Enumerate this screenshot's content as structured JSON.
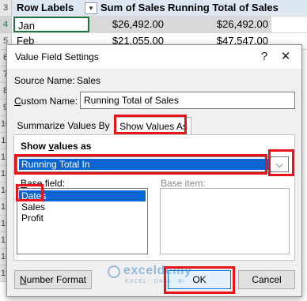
{
  "sheet": {
    "row_numbers": [
      "3",
      "4",
      "5"
    ],
    "headers": {
      "row_labels": "Row Labels",
      "sum_of_sales": "Sum of Sales",
      "running_total": "Running Total of Sales"
    },
    "rows": [
      {
        "label": "Jan",
        "sum": "$26,492.00",
        "running": "$26,492.00"
      },
      {
        "label": "Feb",
        "sum": "$21,055.00",
        "running": "$47,547.00"
      }
    ],
    "side_row_numbers": [
      "6",
      "7",
      "8",
      "9",
      "10",
      "11",
      "12",
      "13",
      "14",
      "15",
      "16",
      "17",
      "18",
      "19"
    ]
  },
  "dialog": {
    "title": "Value Field Settings",
    "help_icon": "question-mark-icon",
    "close_icon": "close-icon",
    "source_name_label": "Source Name:",
    "source_name_value": "Sales",
    "custom_name_label": "Custom Name:",
    "custom_name_value": "Running Total of Sales",
    "tabs": [
      "Summarize Values By",
      "Show Values As"
    ],
    "active_tab": "Show Values As",
    "show_values_as_label": "Show values as",
    "show_values_as_selected": "Running Total In",
    "base_field_label": "Base field:",
    "base_fields": [
      "Dates",
      "Sales",
      "Profit"
    ],
    "base_field_selected": "Dates",
    "base_item_label": "Base item:",
    "number_format_label": "Number Format",
    "ok_label": "OK",
    "cancel_label": "Cancel"
  },
  "watermark": {
    "name": "exceldemy",
    "tagline": "EXCEL · DATA · BI"
  },
  "colors": {
    "highlight_red": "#e8141b",
    "selection_blue": "#0a64d2",
    "excel_green": "#217346"
  }
}
